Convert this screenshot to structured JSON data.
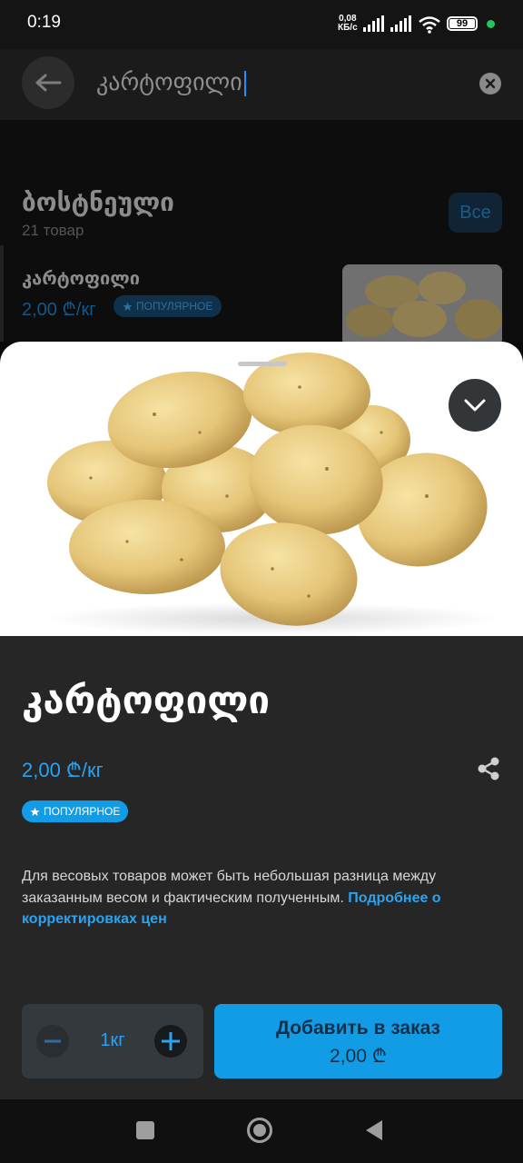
{
  "status_bar": {
    "time": "0:19",
    "net_speed_value": "0,08",
    "net_speed_unit": "КБ/с",
    "battery": "99",
    "dot_color": "#22c55e"
  },
  "search": {
    "query": "კარტოფილი"
  },
  "category": {
    "title": "ბოსტნეული",
    "count": "21 товар",
    "all_button": "Все"
  },
  "list_item": {
    "title": "კარტოფილი",
    "price": "2,00 ₾/кг",
    "badge": "ПОПУЛЯРНОЕ"
  },
  "product": {
    "title": "კარტოფილი",
    "price": "2,00 ₾/кг",
    "badge": "ПОПУЛЯРНОЕ",
    "note_text": "Для весовых товаров может быть небольшая разница между заказанным весом и фактическим полученным. ",
    "note_link": "Подробнее о корректировках цен",
    "quantity": "1кг",
    "add_button_label": "Добавить в заказ",
    "add_button_price": "2,00 ₾"
  },
  "colors": {
    "accent": "#139ce6",
    "sheet_background": "#262626",
    "link": "#2aa3f2"
  },
  "icons": {
    "back": "arrow-left-icon",
    "clear": "close-circle-icon",
    "collapse": "chevron-down-icon",
    "share": "share-icon",
    "star": "star-icon",
    "minus": "minus-icon",
    "plus": "plus-icon",
    "nav_recents": "square-icon",
    "nav_home": "circle-icon",
    "nav_back": "triangle-back-icon"
  }
}
